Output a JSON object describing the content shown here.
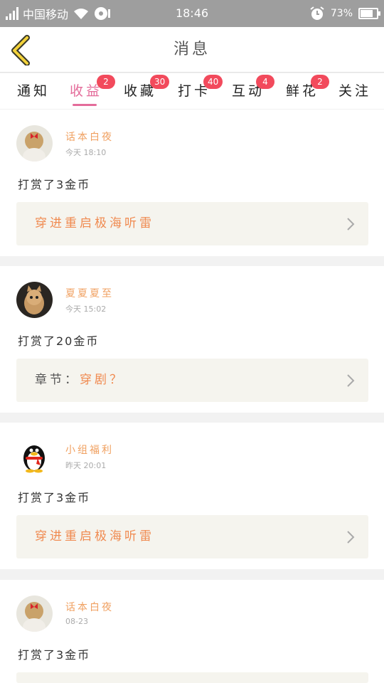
{
  "status_bar": {
    "carrier": "中国移动",
    "time": "18:46",
    "battery": "73%"
  },
  "header": {
    "title": "消息"
  },
  "tabs": [
    {
      "label": "通知",
      "badge": ""
    },
    {
      "label": "收益",
      "badge": "2"
    },
    {
      "label": "收藏",
      "badge": "30"
    },
    {
      "label": "打卡",
      "badge": "40"
    },
    {
      "label": "互动",
      "badge": "4"
    },
    {
      "label": "鲜花",
      "badge": "2"
    },
    {
      "label": "关注",
      "badge": ""
    }
  ],
  "messages": [
    {
      "user": "话本白夜",
      "time": "今天 18:10",
      "text": "打赏了3金币",
      "ref_label": "",
      "ref_title": "穿进重启极海听雷"
    },
    {
      "user": "夏夏夏至",
      "time": "今天 15:02",
      "text": "打赏了20金币",
      "ref_label": "章节：",
      "ref_title": "穿剧？"
    },
    {
      "user": "小组福利",
      "time": "昨天 20:01",
      "text": "打赏了3金币",
      "ref_label": "",
      "ref_title": "穿进重启极海听雷"
    },
    {
      "user": "话本白夜",
      "time": "08-23",
      "text": "打赏了3金币",
      "ref_label": "",
      "ref_title": ""
    }
  ]
}
